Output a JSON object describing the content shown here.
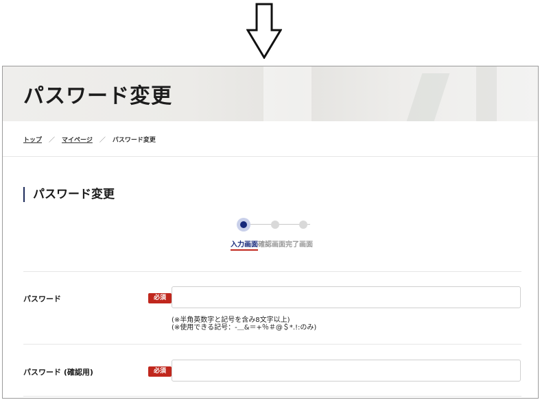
{
  "hero": {
    "title": "パスワード変更"
  },
  "breadcrumb": [
    {
      "label": "トップ"
    },
    {
      "label": "マイページ"
    },
    {
      "label": "パスワード変更"
    }
  ],
  "breadcrumb_separator": "／",
  "section": {
    "title": "パスワード変更"
  },
  "stepper": {
    "steps": [
      "入力画面",
      "確認画面",
      "完了画面"
    ],
    "current_index": 0,
    "colors": {
      "active": "#16287a",
      "active_ring": "#c9d0ea",
      "inactive": "#d9d9d9",
      "underline": "#c0271d"
    }
  },
  "form": {
    "required_label": "必須",
    "password": {
      "label": "パスワード",
      "value": "",
      "notes": [
        "(※半角英数字と記号を含み8文字以上)",
        "(※使用できる記号：-＿&＝+％＃@＄*.!:のみ)"
      ]
    },
    "password_confirm": {
      "label": "パスワード (確認用)",
      "value": ""
    }
  },
  "icons": {
    "down_arrow": "down-arrow-icon"
  }
}
